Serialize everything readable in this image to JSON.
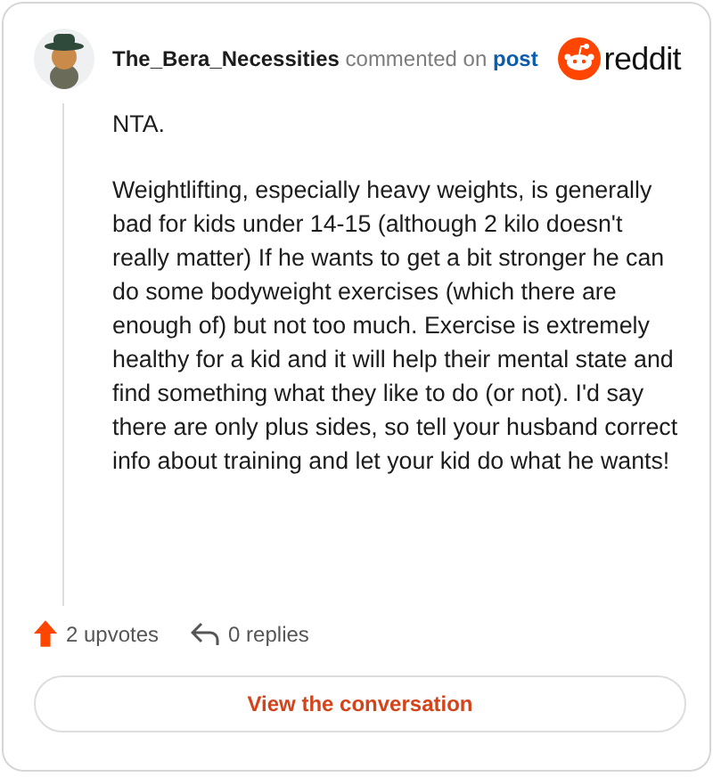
{
  "header": {
    "username": "The_Bera_Necessities",
    "action": "commented on",
    "link": "post",
    "brand": "reddit"
  },
  "paragraphs": [
    "NTA.",
    "Weightlifting, especially heavy weights, is generally bad for kids under 14-15 (although 2 kilo doesn't really matter) If he wants to get a bit stronger he can do some bodyweight exercises (which there are enough of) but not too much. Exercise is extremely healthy for a kid and it will help their mental state and find something what they like to do (or not). I'd say there are only plus sides, so tell your husband correct info about training and let your kid do what he wants!"
  ],
  "footer": {
    "upvotes": "2 upvotes",
    "replies": "0 replies"
  },
  "button": "View the conversation"
}
